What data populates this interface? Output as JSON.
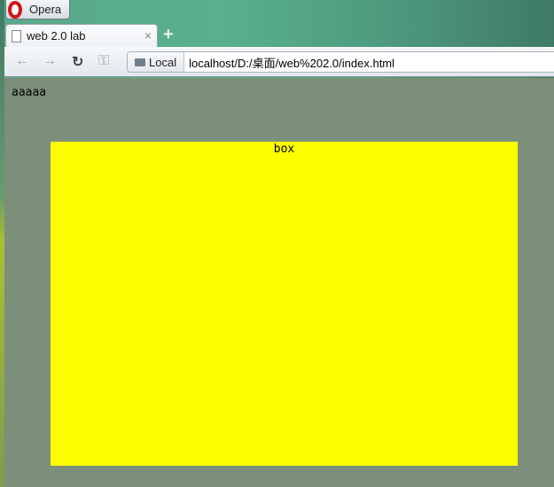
{
  "browser": {
    "menu_label": "Opera",
    "new_tab_symbol": "+",
    "close_symbol": "×"
  },
  "tab": {
    "title": "web 2.0 lab"
  },
  "toolbar": {
    "back": "←",
    "forward": "→",
    "reload": "↻",
    "key": "⚿",
    "security_badge": "Local",
    "url": "localhost/D:/桌面/web%202.0/index.html"
  },
  "page": {
    "text": "aaaaa",
    "box_label": "box",
    "box_color": "#ffff00"
  }
}
